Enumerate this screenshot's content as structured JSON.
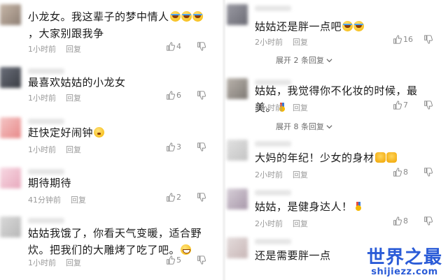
{
  "comment_actions": {
    "reply_label": "回复"
  },
  "left_column": [
    {
      "text": "小龙女。我这辈子的梦中情人",
      "emojis": [
        "cry",
        "cry",
        "cry"
      ],
      "text_tail": "，大家别跟我争",
      "time": "1小时前",
      "likes": "4"
    },
    {
      "text": "最喜欢姑姑的小龙女",
      "emojis": [],
      "text_tail": "",
      "time": "1小时前",
      "likes": "6"
    },
    {
      "text": "赶快定好闹钟",
      "emojis": [
        "think"
      ],
      "text_tail": "",
      "time": "1小时前",
      "likes": "3"
    },
    {
      "text": "期待期待",
      "emojis": [],
      "text_tail": "",
      "time": "41分钟前",
      "likes": "2"
    },
    {
      "text": "姑姑我饿了，你看天气变暖，适合野炊。把我们的大雕烤了吃了吧。",
      "emojis": [
        "grin"
      ],
      "text_tail": "",
      "time": "1小时前",
      "likes": "5"
    }
  ],
  "right_column": [
    {
      "text": "姑姑还是胖一点吧",
      "emojis": [
        "cry",
        "cry"
      ],
      "text_tail": "",
      "time": "2小时前",
      "likes": "16",
      "expand": "展开 2 条回复"
    },
    {
      "text": "姑姑，我觉得你不化妆的时候，最美。",
      "emojis": [
        "medal"
      ],
      "text_tail": "",
      "time": "2小时前",
      "likes": "7",
      "expand": "展开 8 条回复"
    },
    {
      "text": "大妈的年纪！少女的身材",
      "emojis": [
        "fist",
        "fist"
      ],
      "text_tail": "",
      "time": "2小时前",
      "likes": "8"
    },
    {
      "text": "姑姑，是健身达人！",
      "emojis": [
        "medal"
      ],
      "text_tail": "",
      "time": "2小时前",
      "likes": "8"
    },
    {
      "text": "还是需要胖一点",
      "emojis": [],
      "text_tail": "",
      "time": "",
      "likes": ""
    }
  ],
  "watermark": {
    "title": "世界之最",
    "subtitle": "shijiezz.com"
  },
  "colors": {
    "watermark": "#2a5bd7",
    "meta_text": "#9a9a9a",
    "divider": "#f2f2f2"
  }
}
